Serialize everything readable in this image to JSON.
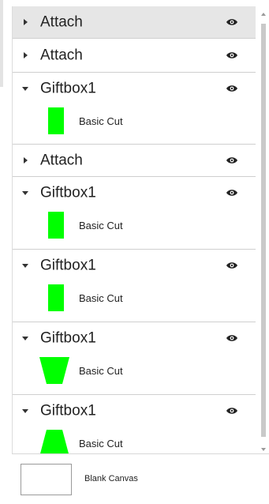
{
  "layers": [
    {
      "title": "Attach",
      "expanded": false,
      "selected": true
    },
    {
      "title": "Attach",
      "expanded": false,
      "selected": false
    },
    {
      "title": "Giftbox1",
      "expanded": true,
      "child_label": "Basic Cut",
      "shape": "rect"
    },
    {
      "title": "Attach",
      "expanded": false,
      "selected": false
    },
    {
      "title": "Giftbox1",
      "expanded": true,
      "child_label": "Basic Cut",
      "shape": "rect"
    },
    {
      "title": "Giftbox1",
      "expanded": true,
      "child_label": "Basic Cut",
      "shape": "rect"
    },
    {
      "title": "Giftbox1",
      "expanded": true,
      "child_label": "Basic Cut",
      "shape": "taper-down"
    },
    {
      "title": "Giftbox1",
      "expanded": true,
      "child_label": "Basic Cut",
      "shape": "taper-up"
    }
  ],
  "footer": {
    "label": "Blank Canvas"
  },
  "colors": {
    "swatch": "#00ff00",
    "selected_row": "#e6e6e6",
    "divider": "#cfcfcf"
  },
  "icons": {
    "expand_collapsed": "caret-right-icon",
    "expand_open": "caret-down-icon",
    "visibility": "eye-icon"
  }
}
